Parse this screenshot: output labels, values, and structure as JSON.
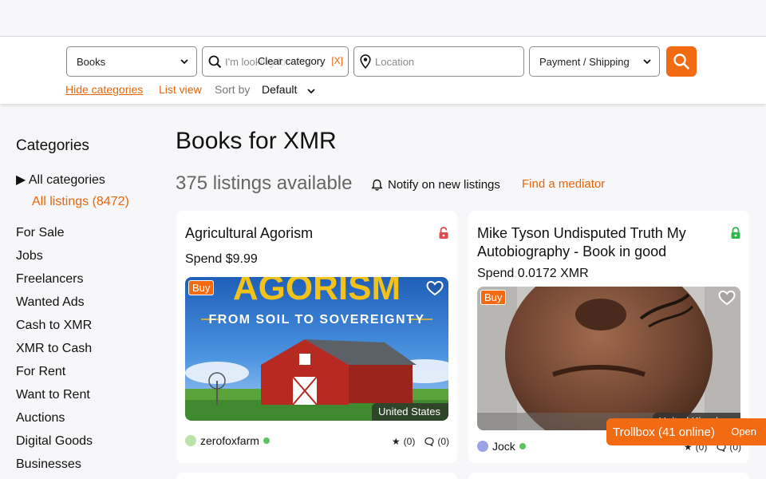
{
  "search": {
    "category_value": "Books",
    "query_placeholder": "I'm looking for...",
    "clear_category_label": "Clear category",
    "clear_category_x": "[X]",
    "location_placeholder": "Location",
    "payment_value": "Payment / Shipping"
  },
  "subnav": {
    "hide_categories": "Hide categories",
    "list_view": "List view",
    "sort_by_label": "Sort by",
    "sort_value": "Default"
  },
  "sidebar": {
    "title": "Categories",
    "all_categories": "▶ All categories",
    "all_listings": "All listings (8472)",
    "items": [
      "For Sale",
      "Jobs",
      "Freelancers",
      "Wanted Ads",
      "Cash to XMR",
      "XMR to Cash",
      "For Rent",
      "Want to Rent",
      "Auctions",
      "Digital Goods",
      "Businesses"
    ]
  },
  "main": {
    "title": "Books for XMR",
    "listings_count": "375 listings available",
    "notify_label": "Notify on new listings",
    "mediator_label": "Find a mediator"
  },
  "listings": [
    {
      "title": "Agricultural Agorism",
      "price": "Spend $9.99",
      "badge": "Buy",
      "image_text_top": "AGORISM",
      "image_text_sub": "FROM SOIL TO SOVEREIGNTY",
      "country": "United States",
      "seller": "zerofoxfarm",
      "rating": "(0)",
      "comments": "(0)",
      "lock_color": "#e04b4b"
    },
    {
      "title": "Mike Tyson Undisputed Truth My Autobiography - Book in good",
      "price": "Spend 0.0172 XMR",
      "badge": "Buy",
      "country": "United Kingdom",
      "seller": "Jock",
      "rating": "(0)",
      "comments": "(0)",
      "lock_color": "#2fb84a"
    }
  ],
  "trollbox": {
    "label": "Trollbox (41 online)",
    "open_label": "Open"
  },
  "colors": {
    "accent": "#f26a12",
    "link": "#e8650a",
    "online": "#5cc25c"
  }
}
